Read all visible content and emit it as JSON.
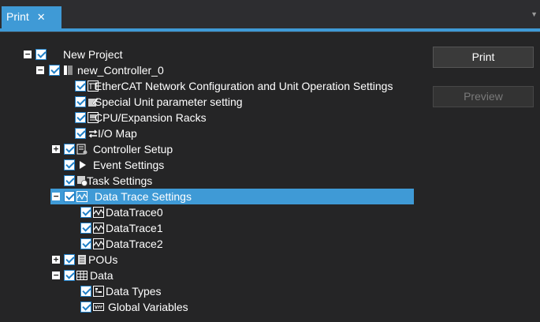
{
  "tab": {
    "title": "Print",
    "close": "✕"
  },
  "buttons": {
    "print": "Print",
    "preview": "Preview"
  },
  "tree": {
    "root": "New Project",
    "controller": "new_Controller_0",
    "ethercat": "EtherCAT Network Configuration and Unit Operation Settings",
    "special_unit": "Special Unit parameter setting",
    "cpu_racks": "CPU/Expansion Racks",
    "io_map": "I/O Map",
    "controller_setup": "Controller Setup",
    "event_settings": "Event Settings",
    "task_settings": "Task Settings",
    "data_trace_settings": "Data Trace Settings",
    "datatrace0": "DataTrace0",
    "datatrace1": "DataTrace1",
    "datatrace2": "DataTrace2",
    "pous": "POUs",
    "data": "Data",
    "data_types": "Data Types",
    "global_variables": "Global Variables"
  },
  "expanders": {
    "collapse": "−",
    "expand": "+"
  },
  "icons": {
    "ethercat": "ethercat-icon",
    "special_unit": "pencil-icon",
    "cpu": "rack-icon",
    "io_map": "arrows-icon",
    "controller_setup": "setup-icon",
    "event": "flag-icon",
    "task": "task-icon",
    "trace": "waveform-icon",
    "pous": "document-icon",
    "data": "table-icon",
    "types": "tree-icon",
    "var": "var-icon"
  },
  "colors": {
    "accent": "#3f9ad6",
    "background": "#252526"
  }
}
